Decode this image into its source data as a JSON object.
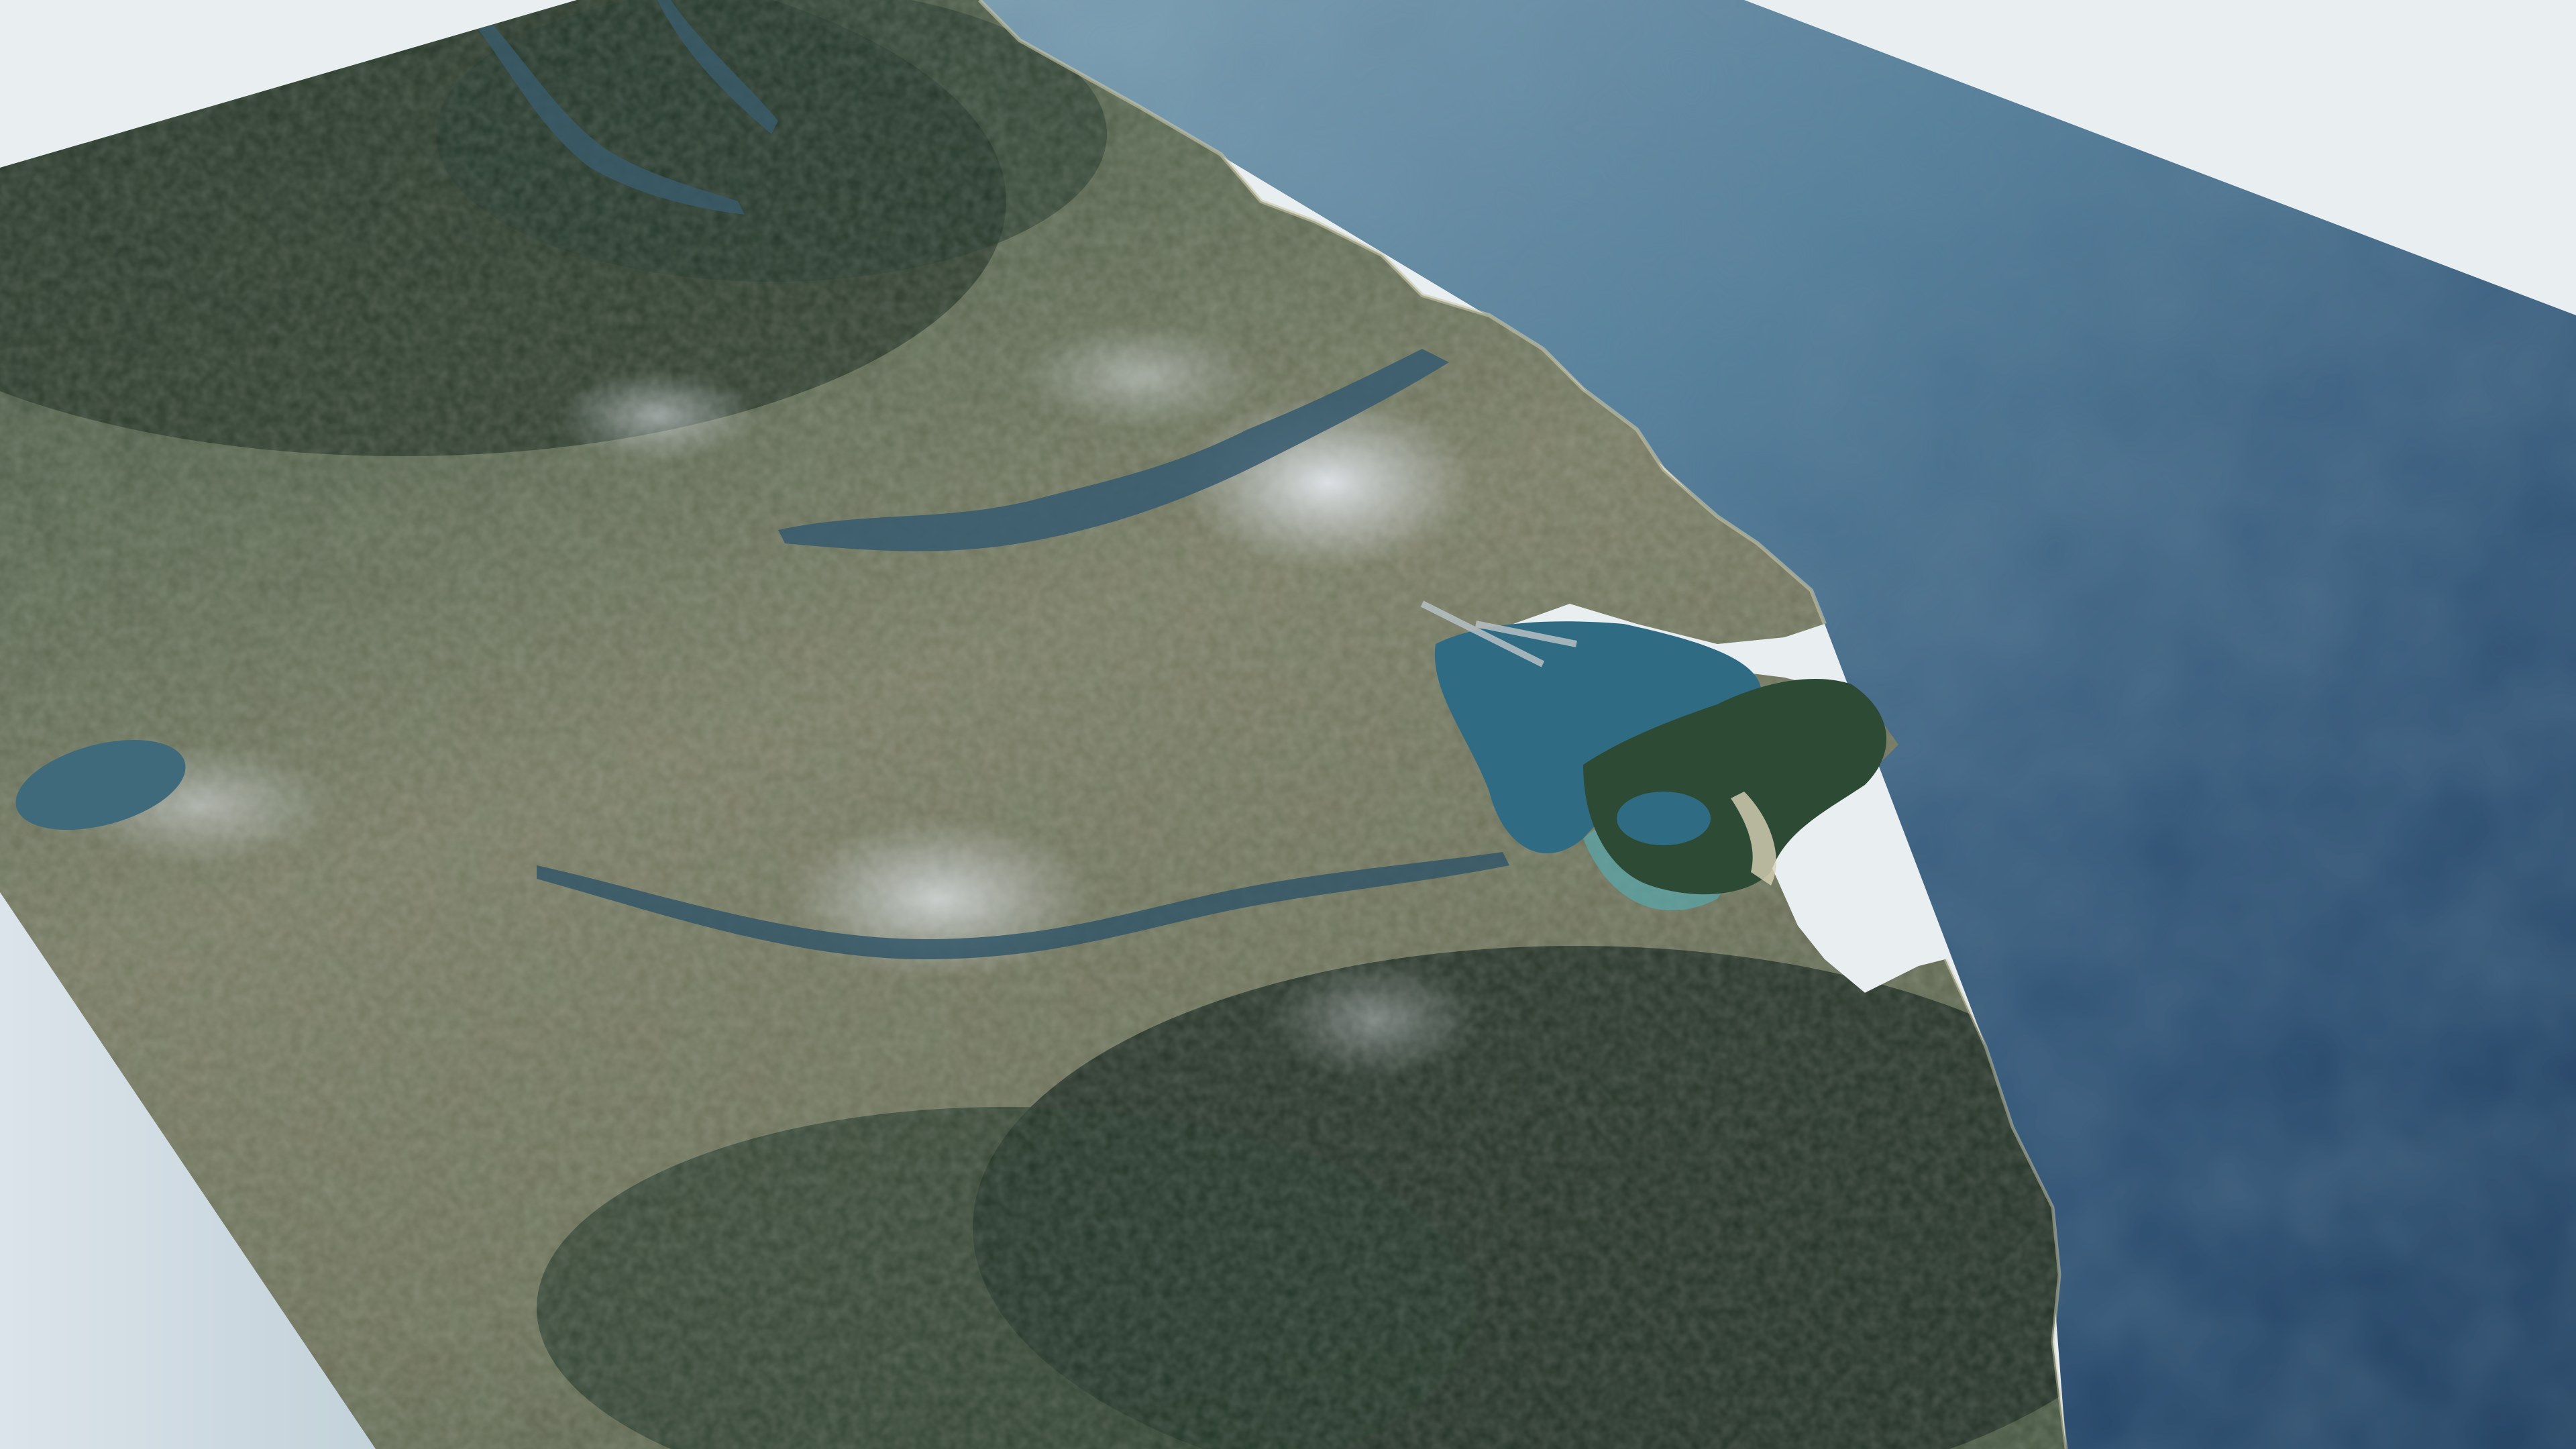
{
  "scene": {
    "kind": "3d-satellite-terrain-tile",
    "view": "oblique",
    "content_description_visible_text": "",
    "colors": {
      "background": "#e9eef1",
      "slab_side": "#cdd9e0",
      "ocean_near": "#6f93a8",
      "ocean_far": "#1f3d5e",
      "ocean_patch": "#2c4a63",
      "forest_dark": "#1f2f22",
      "forest": "#2e4630",
      "vegetation": "#55674a",
      "urban_mix": "#7b7a63",
      "urban_dense": "#c9cfd6",
      "harbour_water": "#365a70",
      "bay_water": "#2f6c84",
      "shallow_water": "#58a8ad",
      "sand": "#d8d2b7"
    }
  }
}
